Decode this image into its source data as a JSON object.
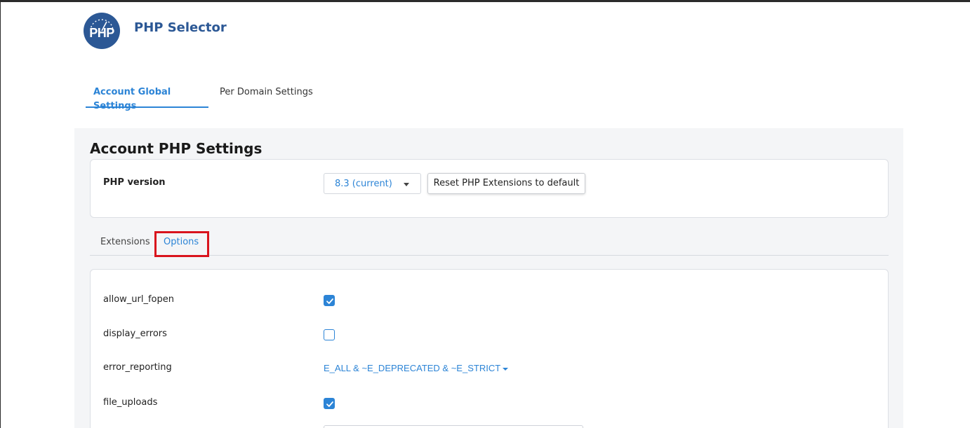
{
  "header": {
    "logo_text": "PHP",
    "title": "PHP Selector"
  },
  "top_tabs": [
    {
      "label": "Account Global Settings",
      "active": true
    },
    {
      "label": "Per Domain Settings",
      "active": false
    }
  ],
  "section": {
    "title": "Account PHP Settings",
    "php_version_label": "PHP version",
    "php_version_value": "8.3 (current)",
    "reset_button_label": "Reset PHP Extensions to default"
  },
  "sub_tabs": [
    {
      "label": "Extensions",
      "active": false
    },
    {
      "label": "Options",
      "active": true
    }
  ],
  "options": [
    {
      "name": "allow_url_fopen",
      "type": "checkbox",
      "checked": true
    },
    {
      "name": "display_errors",
      "type": "checkbox",
      "checked": false
    },
    {
      "name": "error_reporting",
      "type": "dropdown",
      "value": "E_ALL & ~E_DEPRECATED & ~E_STRICT"
    },
    {
      "name": "file_uploads",
      "type": "checkbox",
      "checked": true
    }
  ],
  "colors": {
    "accent": "#2c84d6",
    "brand": "#2c5895",
    "highlight": "#d9141d"
  }
}
